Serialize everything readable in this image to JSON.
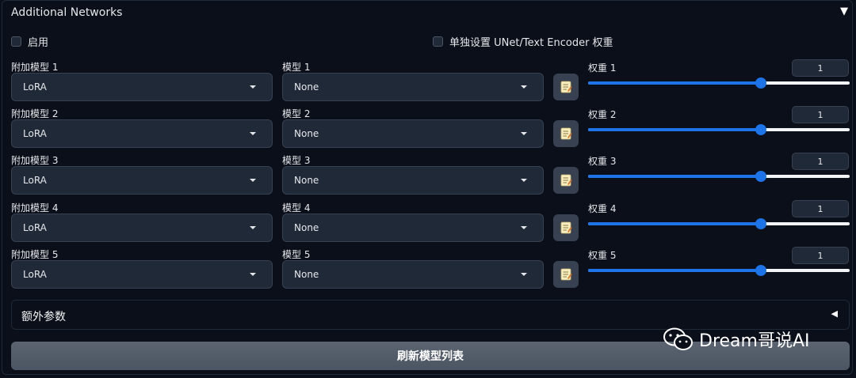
{
  "panel": {
    "title": "Additional Networks",
    "collapse_icon": "▼"
  },
  "checkboxes": {
    "enable": "启用",
    "separate_weights": "单独设置 UNet/Text Encoder 权重"
  },
  "rows": [
    {
      "type_label": "附加模型 1",
      "type_value": "LoRA",
      "model_label": "模型 1",
      "model_value": "None",
      "weight_label": "权重 1",
      "weight_value": "1",
      "slider_level": 0.66
    },
    {
      "type_label": "附加模型 2",
      "type_value": "LoRA",
      "model_label": "模型 2",
      "model_value": "None",
      "weight_label": "权重 2",
      "weight_value": "1",
      "slider_level": 0.66
    },
    {
      "type_label": "附加模型 3",
      "type_value": "LoRA",
      "model_label": "模型 3",
      "model_value": "None",
      "weight_label": "权重 3",
      "weight_value": "1",
      "slider_level": 0.66
    },
    {
      "type_label": "附加模型 4",
      "type_value": "LoRA",
      "model_label": "模型 4",
      "model_value": "None",
      "weight_label": "权重 4",
      "weight_value": "1",
      "slider_level": 0.66
    },
    {
      "type_label": "附加模型 5",
      "type_value": "LoRA",
      "model_label": "模型 5",
      "model_value": "None",
      "weight_label": "权重 5",
      "weight_value": "1",
      "slider_level": 0.66
    }
  ],
  "extra": {
    "label": "额外参数",
    "expand_icon": "◀"
  },
  "refresh_button": "刷新模型列表",
  "watermark": "Dream哥说AI",
  "colors": {
    "accent": "#1d73e8",
    "background": "#0b0f19",
    "input_bg": "#1f2937"
  }
}
